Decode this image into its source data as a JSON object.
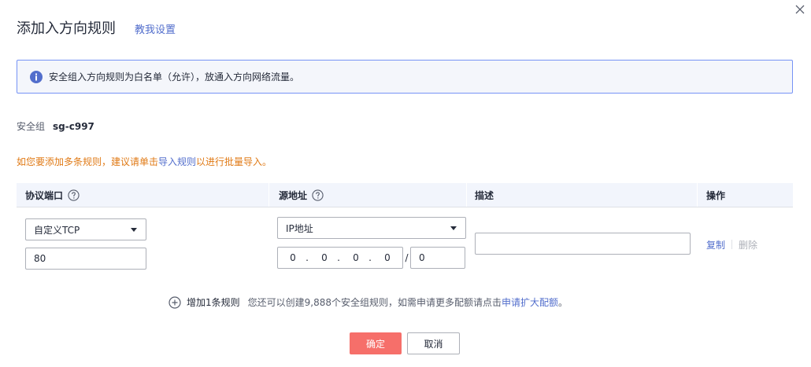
{
  "dialog": {
    "title": "添加入方向规则",
    "help_link": "教我设置",
    "close_icon": "close-icon"
  },
  "info": {
    "icon": "info-icon",
    "text": "安全组入方向规则为白名单（允许），放通入方向网络流量。"
  },
  "security_group": {
    "label": "安全组",
    "value": "sg-c997"
  },
  "batch_tip": {
    "prefix": "如您要添加多条规则，建议请单击",
    "link": "导入规则",
    "suffix": "以进行批量导入。"
  },
  "table": {
    "headers": {
      "protocol_port": "协议端口",
      "source": "源地址",
      "description": "描述",
      "operation": "操作"
    },
    "row": {
      "protocol": "自定义TCP",
      "port": "80",
      "source_type": "IP地址",
      "ip_octets": [
        "0",
        "0",
        "0",
        "0"
      ],
      "ip_dot": ".",
      "ip_slash": "/",
      "mask": "0",
      "description": "",
      "copy": "复制",
      "delete": "删除"
    }
  },
  "add_rule": {
    "label": "增加1条规则",
    "hint_prefix": "您还可以创建9,888个安全组规则，如需申请更多配额请点击",
    "hint_link": "申请扩大配额",
    "hint_suffix": "。"
  },
  "footer": {
    "confirm": "确定",
    "cancel": "取消"
  },
  "colors": {
    "accent_link": "#526ecc",
    "primary_button": "#f66f6a",
    "warning_text": "#e07a16",
    "info_border": "#7693f5",
    "disabled_text": "#adb0b8"
  }
}
